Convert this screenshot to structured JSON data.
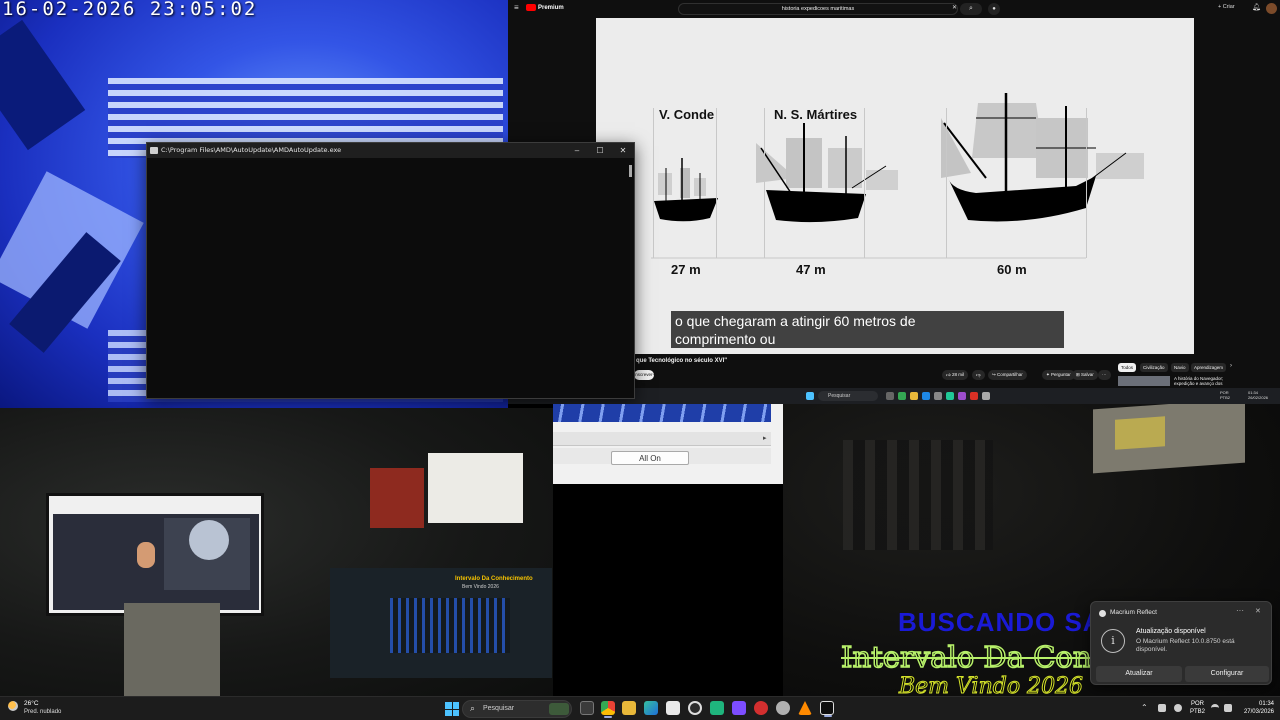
{
  "camera_top_left": {
    "timestamp": "16-02-2026 23:05:02"
  },
  "browser": {
    "logo": "Premium",
    "search_query": "historia expedicoes maritimas",
    "search_clear": "✕",
    "search_button": "⌕",
    "create_label": "+ Criar",
    "video": {
      "ships": [
        {
          "name": "V. Conde",
          "length": "27 m"
        },
        {
          "name": "N. S. Mártires",
          "length": "47 m"
        },
        {
          "name": "",
          "length": "60 m"
        }
      ],
      "subtitle_line1": "o que chegaram a atingir 60 metros de",
      "subtitle_line2": "comprimento ou"
    },
    "video_title": "que Tecnológico no século XVI\"",
    "subscribe_label": "Inscrever-se",
    "actions": {
      "likes": "28 mil",
      "share": "Compartilhar",
      "ask": "Perguntar",
      "save": "Salvar",
      "more": "···"
    },
    "chips": [
      "Todos",
      "Civilização",
      "Navio",
      "Aprendizagem"
    ],
    "chip_next": "›",
    "recommended_title": "A história do Navegador; expedição e avanço dos",
    "inner_taskbar_search": "Pesquisar",
    "inner_tray_lang": "POR\nPTB2",
    "inner_tray_clock": "01:34\n26/02/2026"
  },
  "console": {
    "title": "C:\\Program Files\\AMD\\AutoUpdate\\AMDAutoUpdate.exe",
    "minimize": "–",
    "maximize": "☐",
    "close": "✕"
  },
  "room_camera": {
    "screen_text": "Intervalo Da Conhecimento",
    "screen_subtext": "Bem Vindo 2026"
  },
  "settings_window": {
    "all_on_label": "All On",
    "scroll_arrow": "▸"
  },
  "dark_camera": {
    "overlay_line1": "BUSCANDO SAI",
    "overlay_line2": "Intervalo Da Conh",
    "overlay_line3": "Bem Vindo 2026"
  },
  "notification": {
    "app": "Macrium Reflect",
    "more": "···",
    "close": "✕",
    "info_glyph": "i",
    "title": "Atualização disponível",
    "body": "O Macrium Reflect 10.0.8750 está disponível.",
    "primary_button": "Atualizar",
    "secondary_button": "Configurar"
  },
  "taskbar": {
    "weather_temp": "26°C",
    "weather_desc": "Pred. nublado",
    "search_placeholder": "Pesquisar",
    "search_icon": "⌕",
    "tray_arrow": "⌃",
    "lang_line1": "POR",
    "lang_line2": "PTB2",
    "time": "01:34",
    "date": "27/03/2026"
  }
}
